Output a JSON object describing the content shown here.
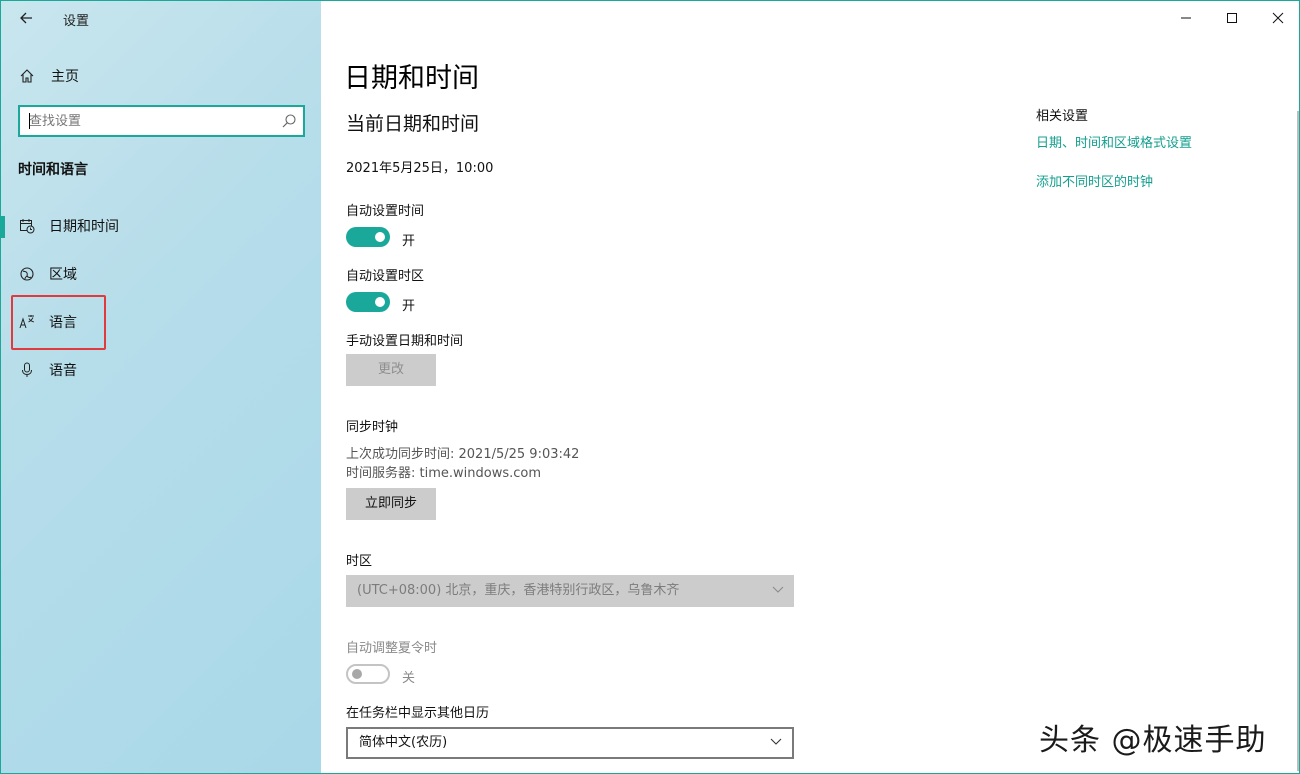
{
  "window": {
    "app_title": "设置"
  },
  "sidebar": {
    "home_label": "主页",
    "search_placeholder": "查找设置",
    "section_title": "时间和语言",
    "items": [
      {
        "label": "日期和时间",
        "icon": "calendar-clock-icon",
        "active": true
      },
      {
        "label": "区域",
        "icon": "globe-icon"
      },
      {
        "label": "语言",
        "icon": "language-icon"
      },
      {
        "label": "语音",
        "icon": "microphone-icon"
      }
    ]
  },
  "main": {
    "page_title": "日期和时间",
    "section_title": "当前日期和时间",
    "current_datetime": "2021年5月25日，10:00",
    "auto_time": {
      "label": "自动设置时间",
      "state": "开"
    },
    "auto_timezone": {
      "label": "自动设置时区",
      "state": "开"
    },
    "manual": {
      "label": "手动设置日期和时间",
      "button": "更改"
    },
    "sync": {
      "title": "同步时钟",
      "last_sync": "上次成功同步时间: 2021/5/25 9:03:42",
      "server": "时间服务器: time.windows.com",
      "button": "立即同步"
    },
    "timezone": {
      "label": "时区",
      "value": "(UTC+08:00) 北京，重庆，香港特别行政区，乌鲁木齐"
    },
    "dst": {
      "label": "自动调整夏令时",
      "state": "关"
    },
    "calendar": {
      "label": "在任务栏中显示其他日历",
      "value": "简体中文(农历)"
    }
  },
  "related": {
    "title": "相关设置",
    "links": [
      "日期、时间和区域格式设置",
      "添加不同时区的时钟"
    ]
  },
  "watermark": "头条 @极速手助",
  "colors": {
    "accent": "#1aa89a",
    "link": "#14a08f",
    "highlight": "#e0393e"
  }
}
